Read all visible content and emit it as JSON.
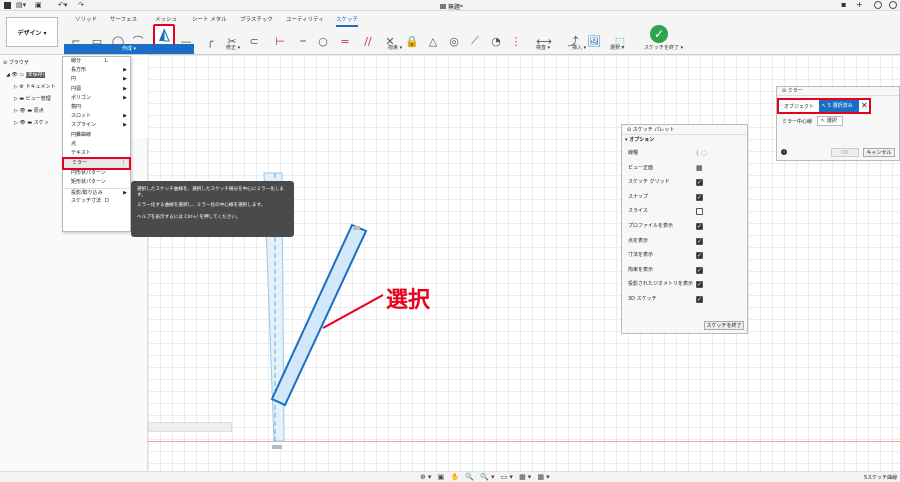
{
  "titlebar": {
    "doc_title": "無題*"
  },
  "workspace_button": {
    "label": "デザイン ▾"
  },
  "tabs": [
    "ソリッド",
    "サーフェス",
    "メッシュ",
    "シート メタル",
    "プラスチック",
    "ユーティリティ",
    "スケッチ"
  ],
  "active_tab": "スケッチ",
  "groups": {
    "create": "作成 ▾",
    "modify": "修正 ▾",
    "constraints": "拘束 ▾",
    "inspect": "検査 ▾",
    "insert": "挿入 ▾",
    "select": "選択 ▾",
    "finish": "スケッチを終了 ▾"
  },
  "browser": {
    "title": "ブラウザ",
    "items": [
      "(未保存)",
      "ドキュメント",
      "ビュー管理",
      "原点",
      "スケッ"
    ]
  },
  "create_menu": {
    "items": [
      {
        "label": "線分",
        "shortcut": "L",
        "submenu": false
      },
      {
        "label": "長方形",
        "shortcut": "",
        "submenu": true
      },
      {
        "label": "円",
        "shortcut": "",
        "submenu": true
      },
      {
        "label": "円弧",
        "shortcut": "",
        "submenu": true
      },
      {
        "label": "ポリゴン",
        "shortcut": "",
        "submenu": true
      },
      {
        "label": "楕円",
        "shortcut": "",
        "submenu": false
      },
      {
        "label": "スロット",
        "shortcut": "",
        "submenu": true
      },
      {
        "label": "スプライン",
        "shortcut": "",
        "submenu": true
      },
      {
        "label": "円錐曲線",
        "shortcut": "",
        "submenu": false
      },
      {
        "label": "点",
        "shortcut": "",
        "submenu": false
      },
      {
        "label": "テキスト",
        "shortcut": "",
        "submenu": false
      },
      {
        "label": "ミラー",
        "shortcut": "",
        "submenu": false
      },
      {
        "label": "円形状パターン",
        "shortcut": "",
        "submenu": false
      },
      {
        "label": "矩形状パターン",
        "shortcut": "",
        "submenu": false
      },
      {
        "label": "投影/取り込み",
        "shortcut": "",
        "submenu": true
      },
      {
        "label": "スケッチ寸法",
        "shortcut": "D",
        "submenu": false
      }
    ]
  },
  "tooltip": {
    "line1": "選択したスケッチ曲線を、選択したスケッチ線分を中心にミラー化します。",
    "line2": "ミラー化する曲線を選択し、ミラー化の中心線を選択します。",
    "line3": "ヘルプを表示するには Ctrl+/ を押してください。"
  },
  "annotation": {
    "text": "選択",
    "color": "#e8001c"
  },
  "sketch_palette": {
    "title": "スケッチ パレット",
    "section": "オプション",
    "rows": [
      {
        "label": "線種",
        "type": "icons",
        "checked": null
      },
      {
        "label": "ビュー正面",
        "type": "icon",
        "checked": null
      },
      {
        "label": "スケッチ グリッド",
        "type": "checkbox",
        "checked": true
      },
      {
        "label": "スナップ",
        "type": "checkbox",
        "checked": true
      },
      {
        "label": "スライス",
        "type": "checkbox",
        "checked": false
      },
      {
        "label": "プロファイルを表示",
        "type": "checkbox",
        "checked": true
      },
      {
        "label": "点を表示",
        "type": "checkbox",
        "checked": true
      },
      {
        "label": "寸法を表示",
        "type": "checkbox",
        "checked": true
      },
      {
        "label": "拘束を表示",
        "type": "checkbox",
        "checked": true
      },
      {
        "label": "投影されたジオメトリを表示",
        "type": "checkbox",
        "checked": true
      },
      {
        "label": "3D スケッチ",
        "type": "checkbox",
        "checked": true
      }
    ],
    "finish_button": "スケッチを終了"
  },
  "mirror_dialog": {
    "title": "ミラー",
    "object_label": "オブジェクト",
    "object_value": "5 選択済み",
    "line_label": "ミラー中心線",
    "line_value": "選択",
    "ok": "OK",
    "cancel": "キャンセル"
  },
  "status": {
    "right": "5スケッチ曲線"
  },
  "colors": {
    "accent": "#1a6fc4",
    "highlight": "#e8001c",
    "finish_green": "#2ea44f"
  }
}
